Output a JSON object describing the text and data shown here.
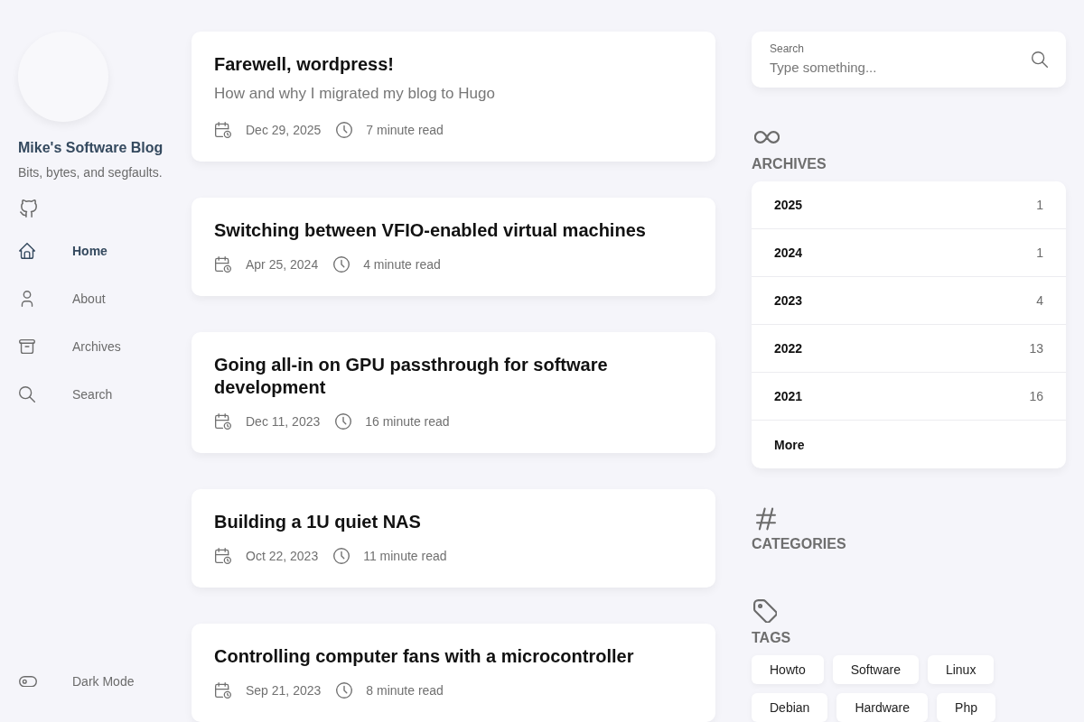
{
  "sidebar": {
    "title": "Mike's Software Blog",
    "subtitle": "Bits, bytes, and segfaults.",
    "nav": [
      {
        "label": "Home",
        "kind": "home",
        "selected": true
      },
      {
        "label": "About",
        "kind": "person",
        "selected": false
      },
      {
        "label": "Archives",
        "kind": "archive",
        "selected": false
      },
      {
        "label": "Search",
        "kind": "search",
        "selected": false
      }
    ],
    "dark_mode": {
      "label": "Dark Mode",
      "on": false
    }
  },
  "posts": [
    {
      "title": "Farewell, wordpress!",
      "subtitle": "How and why I migrated my blog to Hugo",
      "date": "Dec 29, 2025",
      "read_time": "7 minute read"
    },
    {
      "title": "Switching between VFIO-enabled virtual machines",
      "date": "Apr 25, 2024",
      "read_time": "4 minute read"
    },
    {
      "title": "Going all-in on GPU passthrough for software development",
      "date": "Dec 11, 2023",
      "read_time": "16 minute read"
    },
    {
      "title": "Building a 1U quiet NAS",
      "date": "Oct 22, 2023",
      "read_time": "11 minute read"
    },
    {
      "title": "Controlling computer fans with a microcontroller",
      "date": "Sep 21, 2023",
      "read_time": "8 minute read"
    }
  ],
  "search": {
    "label": "Search",
    "placeholder": "Type something..."
  },
  "archives": {
    "heading": "ARCHIVES",
    "years": [
      {
        "year": "2025",
        "count": "1"
      },
      {
        "year": "2024",
        "count": "1"
      },
      {
        "year": "2023",
        "count": "4"
      },
      {
        "year": "2022",
        "count": "13"
      },
      {
        "year": "2021",
        "count": "16"
      }
    ],
    "more": "More"
  },
  "categories": {
    "heading": "CATEGORIES"
  },
  "tags": {
    "heading": "TAGS",
    "items": [
      "Howto",
      "Software",
      "Linux",
      "Debian",
      "Hardware",
      "Php"
    ]
  }
}
